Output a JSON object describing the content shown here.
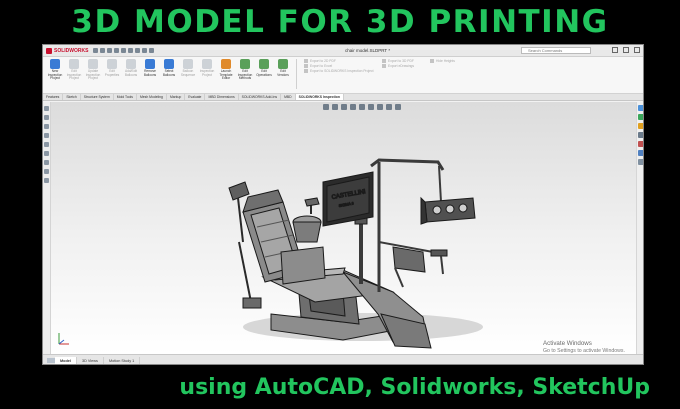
{
  "headline": "3D MODEL FOR 3D PRINTING",
  "footline": "using AutoCAD, Solidworks, SketchUp",
  "app": {
    "brand": "SOLIDWORKS",
    "doc_title": "chair model.SLDPRT *",
    "search_placeholder": "Search Commands"
  },
  "commands": [
    {
      "label": "New Inspection Project",
      "icon": "new-project-icon",
      "enabled": true,
      "tone": "blue"
    },
    {
      "label": "Edit Inspection Project",
      "icon": "edit-project-icon",
      "enabled": false,
      "tone": "gray"
    },
    {
      "label": "Update Inspection Project",
      "icon": "update-project-icon",
      "enabled": false,
      "tone": "gray"
    },
    {
      "label": "Edit Properties",
      "icon": "properties-icon",
      "enabled": false,
      "tone": "gray"
    },
    {
      "label": "Add/Edit Balloons",
      "icon": "add-balloons-icon",
      "enabled": false,
      "tone": "gray"
    },
    {
      "label": "Remove Balloons",
      "icon": "remove-balloons-icon",
      "enabled": true,
      "tone": "blue"
    },
    {
      "label": "Select Balloons",
      "icon": "select-balloons-icon",
      "enabled": true,
      "tone": "blue"
    },
    {
      "label": "Balloon Sequence",
      "icon": "balloon-sequence-icon",
      "enabled": false,
      "tone": "gray"
    },
    {
      "label": "Inspection Project",
      "icon": "inspection-project-icon",
      "enabled": false,
      "tone": "gray"
    },
    {
      "label": "Launch Template Editor",
      "icon": "template-editor-icon",
      "enabled": true,
      "tone": "orange"
    },
    {
      "label": "Edit Inspection Methods",
      "icon": "inspection-methods-icon",
      "enabled": true,
      "tone": "green"
    },
    {
      "label": "Edit Operations",
      "icon": "edit-operations-icon",
      "enabled": true,
      "tone": "green"
    },
    {
      "label": "Edit Vendors",
      "icon": "edit-vendors-icon",
      "enabled": true,
      "tone": "green"
    }
  ],
  "export_left": [
    "Export to 2D PDF",
    "Export to Excel",
    "Export to SOLIDWORKS Inspection Project"
  ],
  "export_right": [
    "Export to 3D PDF",
    "Export eDrawings"
  ],
  "export_extra": [
    "Hide Heights"
  ],
  "tabs": [
    "Features",
    "Sketch",
    "Structure System",
    "Mold Tools",
    "Mesh Modeling",
    "Markup",
    "Evaluate",
    "MBD Dimensions",
    "SOLIDWORKS Add-Ins",
    "MBD",
    "SOLIDWORKS Inspection"
  ],
  "active_tab": "SOLIDWORKS Inspection",
  "bottom_tabs": [
    "Model",
    "3D Views",
    "Motion Study 1"
  ],
  "monitor_text": [
    "CASTELLINI",
    "SKEMA 6"
  ],
  "watermark": {
    "title": "Activate Windows",
    "subtitle": "Go to Settings to activate Windows."
  },
  "colors": {
    "headline": "#22c55e",
    "solidworks_red": "#c8102e",
    "viewport_top": "#dcdcdc",
    "viewport_bottom": "#ffffff"
  }
}
